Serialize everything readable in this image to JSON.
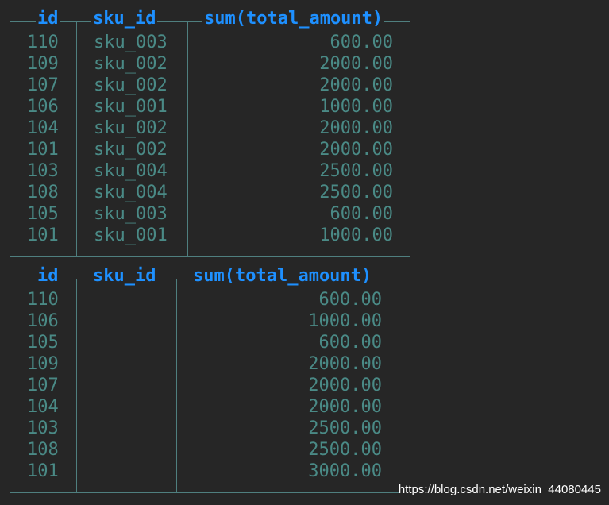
{
  "tables": [
    {
      "columns": [
        "id",
        "sku_id",
        "sum(total_amount)"
      ],
      "rows": [
        [
          "110",
          "sku_003",
          "600.00"
        ],
        [
          "109",
          "sku_002",
          "2000.00"
        ],
        [
          "107",
          "sku_002",
          "2000.00"
        ],
        [
          "106",
          "sku_001",
          "1000.00"
        ],
        [
          "104",
          "sku_002",
          "2000.00"
        ],
        [
          "101",
          "sku_002",
          "2000.00"
        ],
        [
          "103",
          "sku_004",
          "2500.00"
        ],
        [
          "108",
          "sku_004",
          "2500.00"
        ],
        [
          "105",
          "sku_003",
          "600.00"
        ],
        [
          "101",
          "sku_001",
          "1000.00"
        ]
      ]
    },
    {
      "columns": [
        "id",
        "sku_id",
        "sum(total_amount)"
      ],
      "rows": [
        [
          "110",
          "",
          "600.00"
        ],
        [
          "106",
          "",
          "1000.00"
        ],
        [
          "105",
          "",
          "600.00"
        ],
        [
          "109",
          "",
          "2000.00"
        ],
        [
          "107",
          "",
          "2000.00"
        ],
        [
          "104",
          "",
          "2000.00"
        ],
        [
          "103",
          "",
          "2500.00"
        ],
        [
          "108",
          "",
          "2500.00"
        ],
        [
          "101",
          "",
          "3000.00"
        ]
      ]
    }
  ],
  "watermark": "https://blog.csdn.net/weixin_44080445",
  "colors": {
    "background": "#262626",
    "header": "#1e90ff",
    "cell_text": "#4a8a86",
    "border": "#4f7f7f"
  }
}
